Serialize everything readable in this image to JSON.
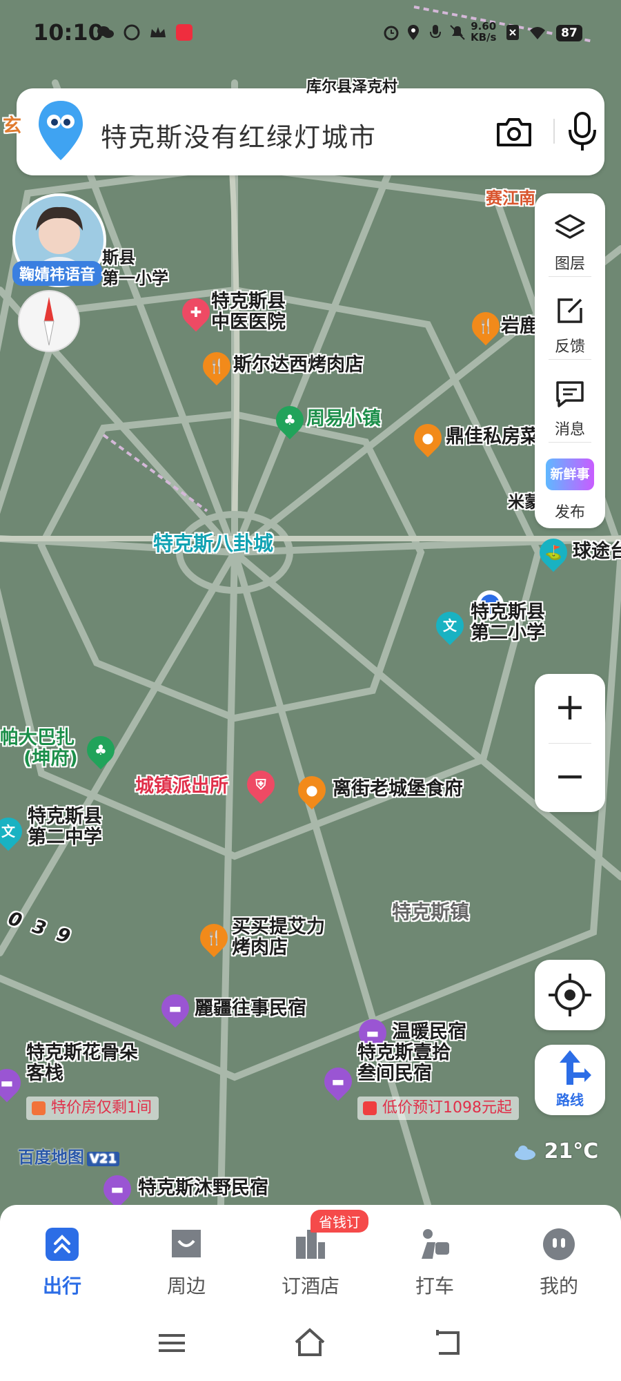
{
  "status_bar": {
    "time": "10:10",
    "net_speed_value": "9.60",
    "net_speed_unit": "KB/s",
    "battery": "87"
  },
  "search": {
    "query": "特克斯没有红绿灯城市"
  },
  "right_panel": {
    "layers": "图层",
    "feedback": "反馈",
    "messages": "消息",
    "publish": "发布",
    "new_badge": "新鲜事"
  },
  "voice_avatar": {
    "label": "鞠婧祎语音"
  },
  "map_labels": {
    "top_road": "库尔县泽克村",
    "left_edge": "玄",
    "saijiang": "赛江南",
    "school_top_1": "斯县",
    "school_top_2": "第一小学",
    "hospital_1": "特克斯县",
    "hospital_2": "中医医院",
    "bbq1": "斯尔达西烤肉店",
    "yanlu": "岩鹿",
    "zhouyi": "周易小镇",
    "dingjia": "鼎佳私房菜",
    "mi": "米蒙小",
    "bagua": "特克斯八卦城",
    "qiutu": "球途台",
    "school2_1": "特克斯县",
    "school2_2": "第二小学",
    "pada_1": "帕大巴扎",
    "pada_2": "(坤府)",
    "police": "城镇派出所",
    "lijie": "离街老城堡食府",
    "mid2_1": "特克斯县",
    "mid2_2": "第二中学",
    "road_num": "039",
    "town": "特克斯镇",
    "bbq2_1": "买买提艾力",
    "bbq2_2": "烤肉店",
    "lijiang": "麗疆往事民宿",
    "wennuan": "温暖民宿",
    "huagu_1": "特克斯花骨朵",
    "huagu_2": "客栈",
    "yishi_1": "特克斯壹拾",
    "yishi_2": "叁间民宿",
    "muye": "特克斯沐野民宿",
    "deal1": "特价房仅剩1间",
    "deal2": "低价预订1098元起"
  },
  "map_brand": {
    "name": "百度地图",
    "version": "V21"
  },
  "weather": {
    "temp": "21°C"
  },
  "route_button": {
    "label": "路线"
  },
  "bottom_nav": {
    "items": [
      {
        "label": "出行"
      },
      {
        "label": "周边"
      },
      {
        "label": "订酒店"
      },
      {
        "label": "打车"
      },
      {
        "label": "我的"
      }
    ],
    "promo": "省钱订"
  },
  "colors": {
    "accent": "#2c6de6",
    "map_bg": "#6f8873"
  }
}
